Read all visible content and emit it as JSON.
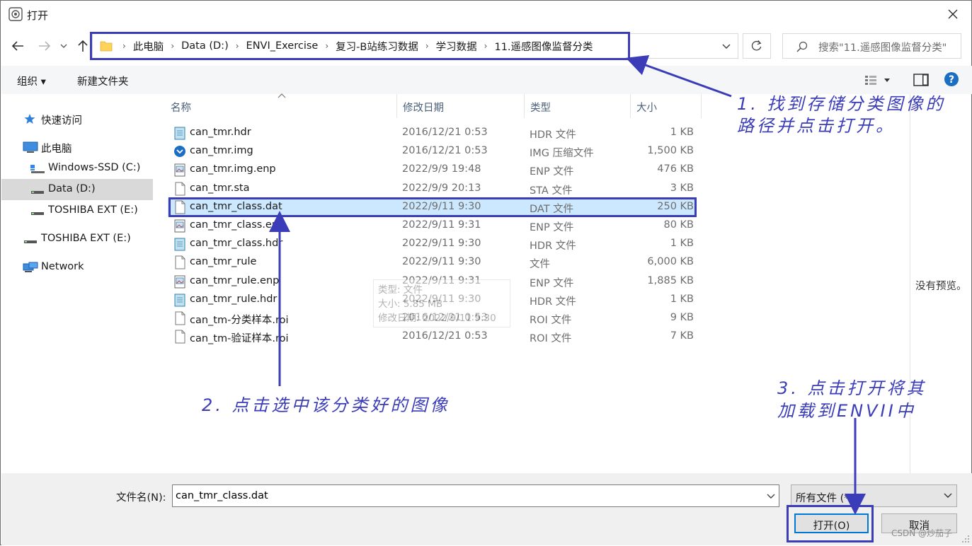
{
  "window": {
    "title": "打开"
  },
  "breadcrumb": [
    "此电脑",
    "Data (D:)",
    "ENVI_Exercise",
    "复习-B站练习数据",
    "学习数据",
    "11.遥感图像监督分类"
  ],
  "search": {
    "placeholder": "搜索\"11.遥感图像监督分类\""
  },
  "toolbar": {
    "organize_label": "组织 ▾",
    "new_folder_label": "新建文件夹"
  },
  "sidebar": {
    "items": [
      {
        "label": "快速访问"
      },
      {
        "label": "此电脑"
      },
      {
        "label": "Windows-SSD (C:)"
      },
      {
        "label": "Data (D:)"
      },
      {
        "label": "TOSHIBA EXT (E:)"
      },
      {
        "label": "TOSHIBA EXT (E:)"
      },
      {
        "label": "Network"
      }
    ]
  },
  "columns": {
    "name": "名称",
    "date": "修改日期",
    "type": "类型",
    "size": "大小"
  },
  "files": [
    {
      "name": "can_tmr.hdr",
      "date": "2016/12/21 0:53",
      "type": "HDR 文件",
      "size": "1 KB",
      "icon": "notepad-icon"
    },
    {
      "name": "can_tmr.img",
      "date": "2016/12/21 0:53",
      "type": "IMG 压缩文件",
      "size": "1,500 KB",
      "icon": "disc-image-icon"
    },
    {
      "name": "can_tmr.img.enp",
      "date": "2022/9/9 19:48",
      "type": "ENP 文件",
      "size": "476 KB",
      "icon": "image-file-icon"
    },
    {
      "name": "can_tmr.sta",
      "date": "2022/9/9 20:13",
      "type": "STA 文件",
      "size": "3 KB",
      "icon": "blank-file-icon"
    },
    {
      "name": "can_tmr_class.dat",
      "date": "2022/9/11 9:30",
      "type": "DAT 文件",
      "size": "250 KB",
      "icon": "blank-file-icon"
    },
    {
      "name": "can_tmr_class.enp",
      "date": "2022/9/11 9:31",
      "type": "ENP 文件",
      "size": "80 KB",
      "icon": "image-file-icon"
    },
    {
      "name": "can_tmr_class.hdr",
      "date": "2022/9/11 9:30",
      "type": "HDR 文件",
      "size": "1 KB",
      "icon": "notepad-icon"
    },
    {
      "name": "can_tmr_rule",
      "date": "2022/9/11 9:30",
      "type": "文件",
      "size": "6,000 KB",
      "icon": "blank-file-icon"
    },
    {
      "name": "can_tmr_rule.enp",
      "date": "2022/9/11 9:31",
      "type": "ENP 文件",
      "size": "1,885 KB",
      "icon": "image-file-icon"
    },
    {
      "name": "can_tmr_rule.hdr",
      "date": "2022/9/11 9:30",
      "type": "HDR 文件",
      "size": "1 KB",
      "icon": "notepad-icon"
    },
    {
      "name": "can_tm-分类样本.roi",
      "date": "2016/12/21 0:53",
      "type": "ROI 文件",
      "size": "9 KB",
      "icon": "blank-file-icon"
    },
    {
      "name": "can_tm-验证样本.roi",
      "date": "2016/12/21 0:53",
      "type": "ROI 文件",
      "size": "7 KB",
      "icon": "blank-file-icon"
    }
  ],
  "tooltip": {
    "type_line": "类型: 文件",
    "size_line": "大小: 5.85 MB",
    "date_line": "修改日期: 2022/9/11 9:30"
  },
  "preview": {
    "text": "没有预览。"
  },
  "bottom": {
    "filename_label": "文件名(N):",
    "filename_value": "can_tmr_class.dat",
    "filter_value": "所有文件 (*.*)",
    "open_label": "打开(O)",
    "cancel_label": "取消"
  },
  "annotations": {
    "step1_line1": "1. 找到存储分类图像的",
    "step1_line2": "路径并点击打开。",
    "step2": "2. 点击选中该分类好的图像",
    "step3_line1": "3. 点击打开将其",
    "step3_line2": "加载到ENVII中"
  },
  "watermark": "CSDN @炒茄子",
  "colors": {
    "annotation": "#3b3db8",
    "selection": "#cce8ff",
    "accent": "#0078d7"
  }
}
